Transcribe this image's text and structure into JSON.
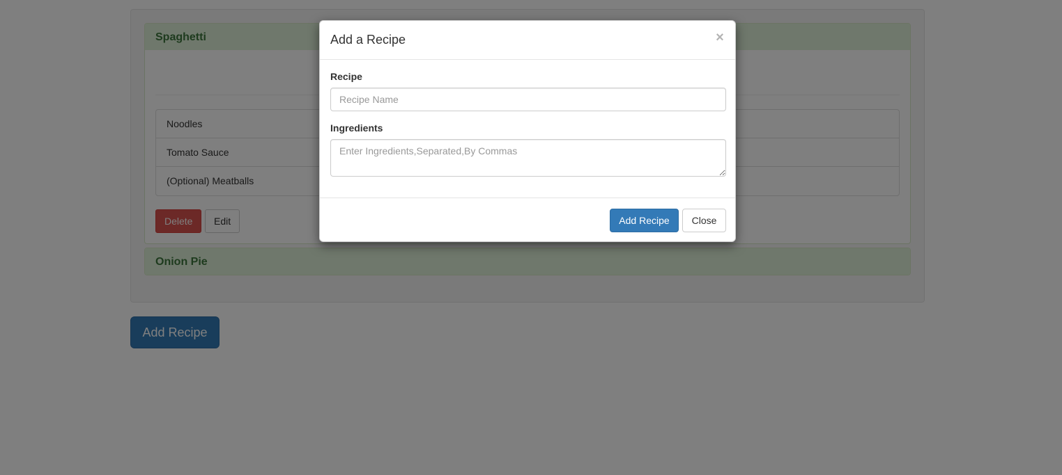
{
  "recipes": [
    {
      "name": "Spaghetti",
      "ingredients": [
        "Noodles",
        "Tomato Sauce",
        "(Optional) Meatballs"
      ],
      "delete_label": "Delete",
      "edit_label": "Edit"
    },
    {
      "name": "Onion Pie"
    }
  ],
  "main": {
    "add_recipe_label": "Add Recipe"
  },
  "modal": {
    "title": "Add a Recipe",
    "close_symbol": "×",
    "recipe_label": "Recipe",
    "recipe_placeholder": "Recipe Name",
    "recipe_value": "",
    "ingredients_label": "Ingredients",
    "ingredients_placeholder": "Enter Ingredients,Separated,By Commas",
    "ingredients_value": "",
    "add_button_label": "Add Recipe",
    "close_button_label": "Close"
  },
  "colors": {
    "primary": "#337ab7",
    "danger": "#d9534f",
    "panel_heading_bg": "#dff0d8",
    "panel_heading_text": "#3c763d"
  }
}
